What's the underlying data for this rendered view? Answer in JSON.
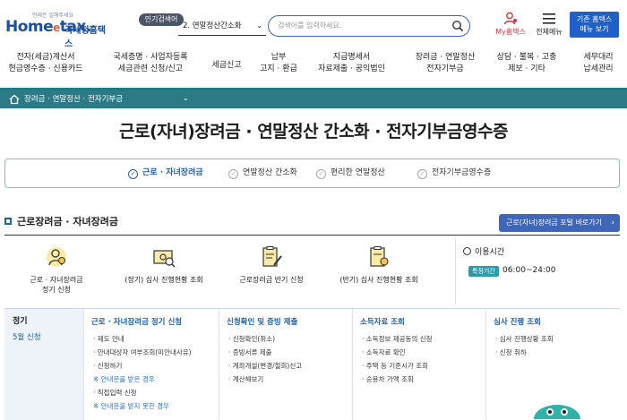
{
  "header": {
    "logo_tag": "언제든 일해주세요",
    "logo_main": "Home",
    "logo_e": "e",
    "logo_tax": "tax.",
    "logo_sub": "국세청홈택스",
    "popular_label": "인기검색어",
    "popular_value": "2.  연말정산간소화",
    "search_placeholder": "검색어를 입력하세요.",
    "myhome_label": "My홈택스",
    "allmenu_label": "전체메뉴",
    "old_btn_line1": "기존 홈택스",
    "old_btn_line2": "메뉴 보기"
  },
  "nav": [
    {
      "l1": "전자(세금)계산서",
      "l2": "현금영수증 · 신용카드"
    },
    {
      "l1": "국세증명 · 사업자등록",
      "l2": "세금관련 신청/신고"
    },
    {
      "l1": "세금신고",
      "l2": ""
    },
    {
      "l1": "납부",
      "l2": "고지 · 환급"
    },
    {
      "l1": "지급명세서",
      "l2": "자료제출 · 공익법인"
    },
    {
      "l1": "장려금 · 연말정산",
      "l2": "전자기부금"
    },
    {
      "l1": "상담 · 불복 · 고충",
      "l2": "제보 · 기타"
    },
    {
      "l1": "세무대리",
      "l2": "납세관리"
    }
  ],
  "breadcrumb": "장려금 · 연말정산 · 전자기부금",
  "page_title": "근로(자녀)장려금 · 연말정산 간소화 · 전자기부금영수증",
  "tabs": [
    {
      "label": "근로 · 자녀장려금",
      "active": true
    },
    {
      "label": "연말정산 간소화",
      "active": false
    },
    {
      "label": "편리한 연말정산",
      "active": false
    },
    {
      "label": "전자기부금영수증",
      "active": false
    }
  ],
  "section": {
    "title": "근로장려금 · 자녀장려금",
    "portal_btn": "근로(자녀)장려금 포털 바로가기"
  },
  "quick": [
    {
      "l1": "근로 · 자녀장려금",
      "l2": "정기 신청",
      "icon": "person-coin-icon"
    },
    {
      "l1": "(정기) 심사 진행현황 조회",
      "l2": "",
      "icon": "money-search-icon"
    },
    {
      "l1": "근로장려금 반기 신청",
      "l2": "",
      "icon": "clipboard-pen-icon"
    },
    {
      "l1": "(반기) 심사 진행현황 조회",
      "l2": "",
      "icon": "clipboard-coin-icon"
    }
  ],
  "hours": {
    "title": "이용시간",
    "badge": "특정기간",
    "time": "06:00~24:00"
  },
  "table": {
    "left_title": "정기",
    "left_sub": "5월 신청",
    "columns": [
      {
        "head": "근로 · 자녀장려금 정기 신청",
        "items": [
          "· 제도 안내",
          "· 안내대상자 여부조회(미안내사유)",
          "· 신청하기",
          "※ 안내문을 받은 경우",
          "· 직접입력 신청",
          "※ 안내문을 받지 못한 경우"
        ]
      },
      {
        "head": "신청확인 및 증빙 제출",
        "items": [
          "· 신청확인(취소)",
          "· 증빙서류 제출",
          "· 계좌개설(변경/철회)신고",
          "· 계산해보기"
        ]
      },
      {
        "head": "소득자료 조회",
        "items": [
          "· 소득정보 제공동의 신청",
          "· 소득자료 확인",
          "· 주택 등 기준시가 조회",
          "· 승용차 가액 조회"
        ]
      },
      {
        "head": "심사 진행 조회",
        "items": [
          "· 심사 진행상황 조회",
          "· 신청 취하"
        ]
      }
    ]
  },
  "colors": {
    "brand": "#1d4fa0",
    "teal": "#2c7a86",
    "accent": "#2260c9"
  }
}
